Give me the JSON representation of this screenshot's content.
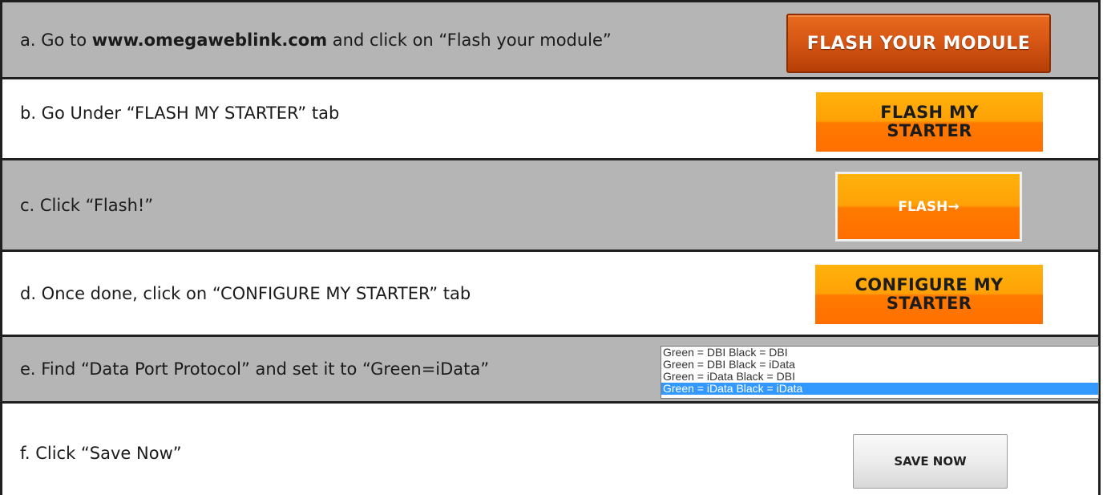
{
  "steps": {
    "a": {
      "prefix": "a.  Go to ",
      "link": "www.omegaweblink.com",
      "suffix": " and click on “Flash your module”",
      "button": "FLASH YOUR MODULE"
    },
    "b": {
      "text": "b.  Go Under “FLASH MY STARTER” tab",
      "button_line1": "FLASH MY",
      "button_line2": "STARTER"
    },
    "c": {
      "text": "c.  Click “Flash!”",
      "button": "FLASH→"
    },
    "d": {
      "text": "d.  Once done, click on “CONFIGURE MY STARTER” tab",
      "button_line1": "CONFIGURE MY",
      "button_line2": "STARTER"
    },
    "e": {
      "text": "e.  Find “Data Port Protocol” and set it to “Green=iData”",
      "options": [
        "Green = DBI Black = DBI",
        "Green = DBI Black = iData",
        "Green = iData Black = DBI",
        "Green = iData Black = iData"
      ],
      "selected_option": "Green = iData Black = iData"
    },
    "f": {
      "text": "f.  Click “Save Now”",
      "button": "SAVE NOW"
    }
  },
  "colors": {
    "gray_row": "#b5b5b5",
    "orange": "#ff8c00",
    "dark_orange": "#c9470a",
    "selected": "#3399ff"
  }
}
